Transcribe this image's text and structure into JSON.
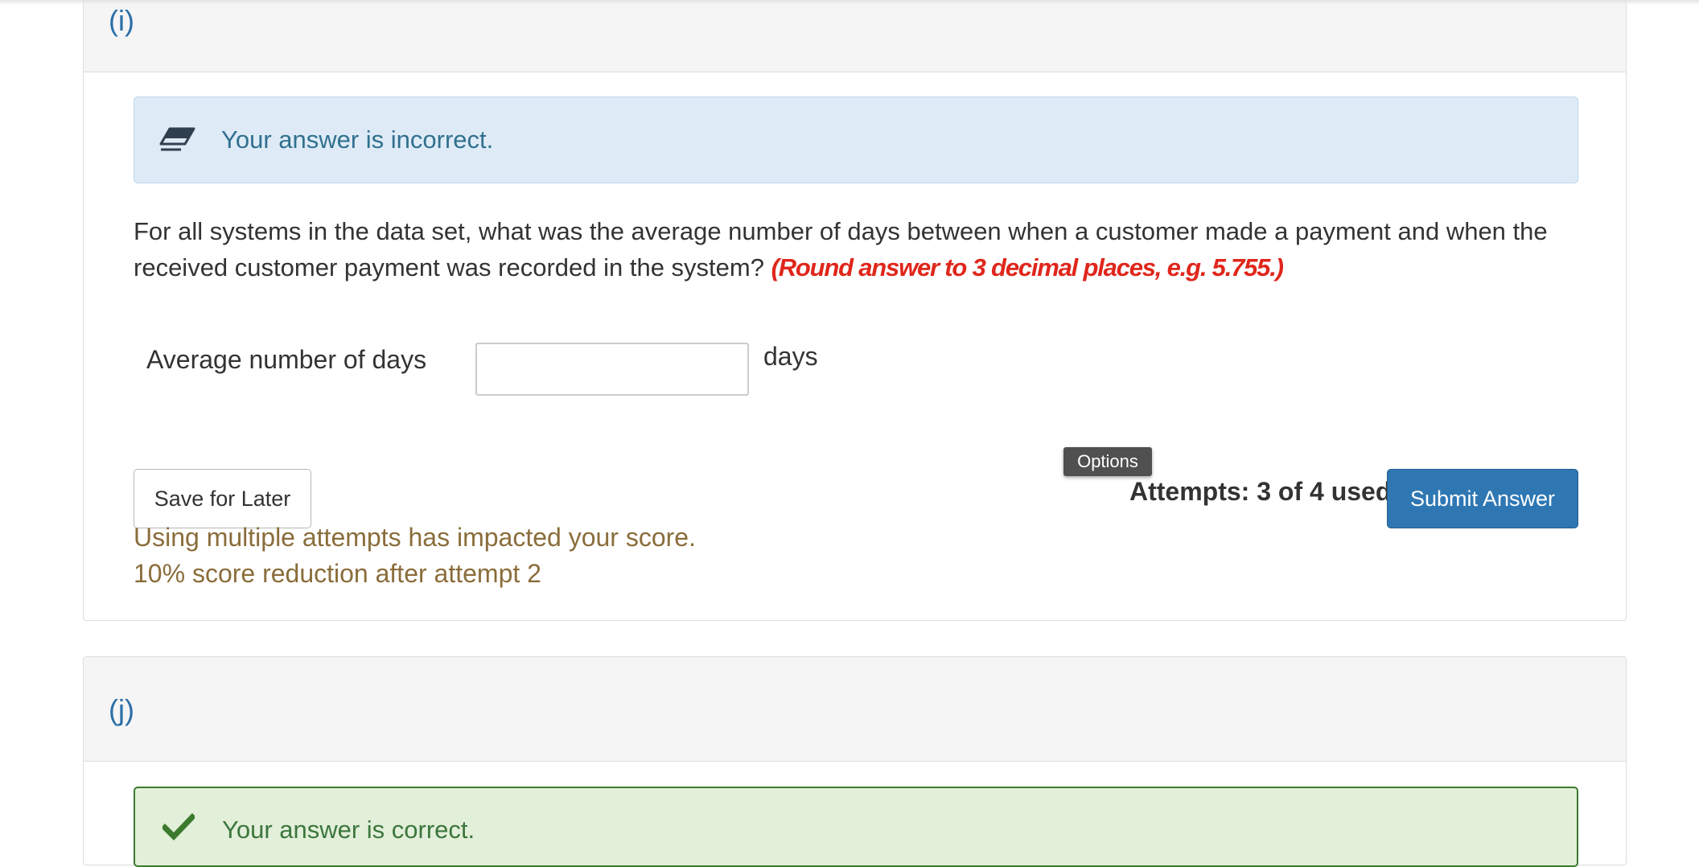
{
  "part_i": {
    "label": "(i)",
    "alert": {
      "icon": "eraser-icon",
      "text": "Your answer is incorrect."
    },
    "question": {
      "text": "For all systems in the data set, what was the average number of days between when a customer made a payment and when the received customer payment was recorded in the system?",
      "hint": "(Round answer to 3 decimal places, e.g. 5.755.)"
    },
    "answer": {
      "label": "Average number of days",
      "value": "",
      "unit": "days"
    },
    "save_label": "Save for Later",
    "tooltip": "Options",
    "attempts": "Attempts: 3 of 4 used",
    "submit_label": "Submit Answer",
    "penalty": [
      "Using multiple attempts has impacted your score.",
      "10% score reduction after attempt 2"
    ]
  },
  "part_j": {
    "label": "(j)",
    "alert": {
      "icon": "checkmark-icon",
      "text": "Your answer is correct."
    }
  },
  "colors": {
    "link_blue": "#2a6fa8",
    "info_bg": "#deebf6",
    "info_text": "#31708f",
    "hint_red": "#e0261b",
    "warning_text": "#8a6d3b",
    "primary_button": "#2e77b3",
    "success_bg": "#e2efd9",
    "success_border": "#3c7a2e"
  }
}
